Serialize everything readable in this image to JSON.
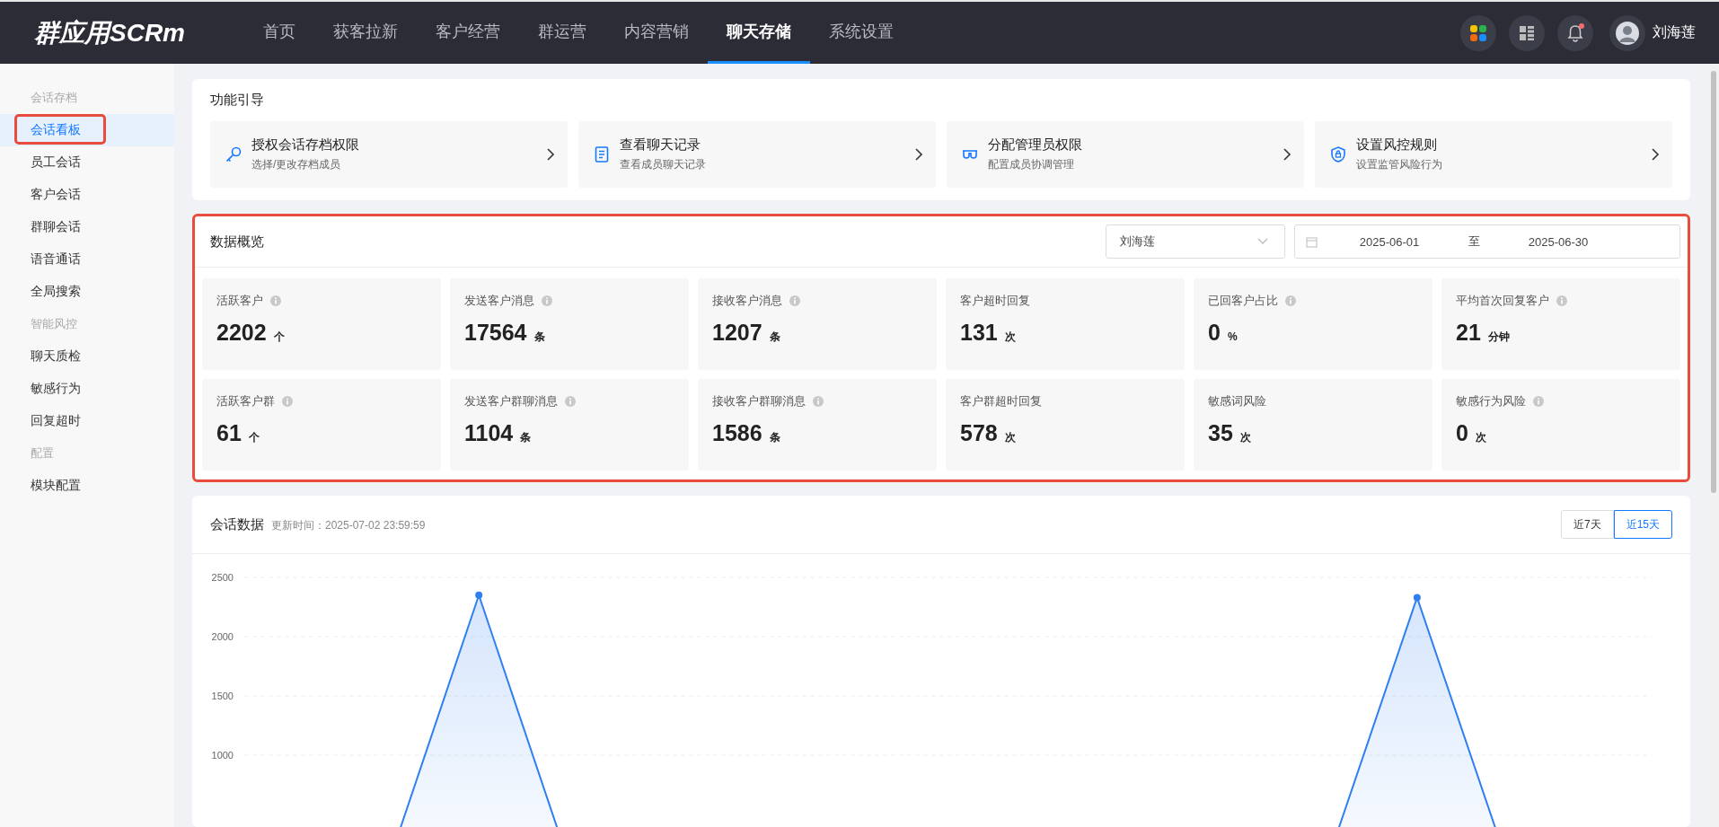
{
  "header": {
    "logo": "群应用SCRm",
    "nav": [
      {
        "label": "首页",
        "selected": false
      },
      {
        "label": "获客拉新",
        "selected": false
      },
      {
        "label": "客户经营",
        "selected": false
      },
      {
        "label": "群运营",
        "selected": false
      },
      {
        "label": "内容营销",
        "selected": false
      },
      {
        "label": "聊天存储",
        "selected": true
      },
      {
        "label": "系统设置",
        "selected": false
      }
    ],
    "notification_dot": true,
    "user": {
      "name": "刘海莲"
    }
  },
  "sidebar": {
    "sections": [
      {
        "title": "会话存档",
        "items": [
          {
            "label": "会话看板",
            "selected": true,
            "highlighted": true
          },
          {
            "label": "员工会话",
            "selected": false,
            "highlighted": false
          },
          {
            "label": "客户会话",
            "selected": false,
            "highlighted": false
          },
          {
            "label": "群聊会话",
            "selected": false,
            "highlighted": false
          },
          {
            "label": "语音通话",
            "selected": false,
            "highlighted": false
          },
          {
            "label": "全局搜索",
            "selected": false,
            "highlighted": false
          }
        ]
      },
      {
        "title": "智能风控",
        "items": [
          {
            "label": "聊天质检",
            "selected": false,
            "highlighted": false
          },
          {
            "label": "敏感行为",
            "selected": false,
            "highlighted": false
          },
          {
            "label": "回复超时",
            "selected": false,
            "highlighted": false
          }
        ]
      },
      {
        "title": "配置",
        "items": [
          {
            "label": "模块配置",
            "selected": false,
            "highlighted": false
          }
        ]
      }
    ]
  },
  "guide": {
    "title": "功能引导",
    "cards": [
      {
        "kind": "key",
        "title": "授权会话存档权限",
        "subtitle": "选择/更改存档成员"
      },
      {
        "kind": "document",
        "title": "查看聊天记录",
        "subtitle": "查看成员聊天记录"
      },
      {
        "kind": "glasses",
        "title": "分配管理员权限",
        "subtitle": "配置成员协调管理"
      },
      {
        "kind": "shield",
        "title": "设置风控规则",
        "subtitle": "设置监管风险行为"
      }
    ]
  },
  "overview": {
    "title": "数据概览",
    "highlighted": true,
    "member_select": {
      "value": "刘海莲"
    },
    "date_range": {
      "start": "2025-06-01",
      "separator": "至",
      "end": "2025-06-30"
    },
    "stats": [
      {
        "label": "活跃客户",
        "info": true,
        "value": "2202",
        "unit": "个"
      },
      {
        "label": "发送客户消息",
        "info": true,
        "value": "17564",
        "unit": "条"
      },
      {
        "label": "接收客户消息",
        "info": true,
        "value": "1207",
        "unit": "条"
      },
      {
        "label": "客户超时回复",
        "info": false,
        "value": "131",
        "unit": "次"
      },
      {
        "label": "已回客户占比",
        "info": true,
        "value": "0",
        "unit": "%"
      },
      {
        "label": "平均首次回复客户",
        "info": true,
        "value": "21",
        "unit": "分钟"
      },
      {
        "label": "活跃客户群",
        "info": true,
        "value": "61",
        "unit": "个"
      },
      {
        "label": "发送客户群聊消息",
        "info": true,
        "value": "1104",
        "unit": "条"
      },
      {
        "label": "接收客户群聊消息",
        "info": true,
        "value": "1586",
        "unit": "条"
      },
      {
        "label": "客户群超时回复",
        "info": false,
        "value": "578",
        "unit": "次"
      },
      {
        "label": "敏感词风险",
        "info": false,
        "value": "35",
        "unit": "次"
      },
      {
        "label": "敏感行为风险",
        "info": true,
        "value": "0",
        "unit": "次"
      }
    ]
  },
  "chat_data": {
    "title": "会话数据",
    "updated": "更新时间：2025-07-02 23:59:59",
    "ranges": [
      {
        "label": "近7天",
        "selected": false
      },
      {
        "label": "近15天",
        "selected": true
      }
    ],
    "chart_data": {
      "type": "area",
      "grid": true,
      "ylim": [
        0,
        2500
      ],
      "yticks": [
        1000,
        1500,
        2000,
        2500
      ],
      "series": [
        {
          "color": "#2f7ff0",
          "values": [
            0,
            0,
            2350,
            0,
            0,
            0,
            0,
            0,
            0,
            0,
            0,
            0,
            2330,
            0,
            0
          ]
        }
      ]
    }
  }
}
